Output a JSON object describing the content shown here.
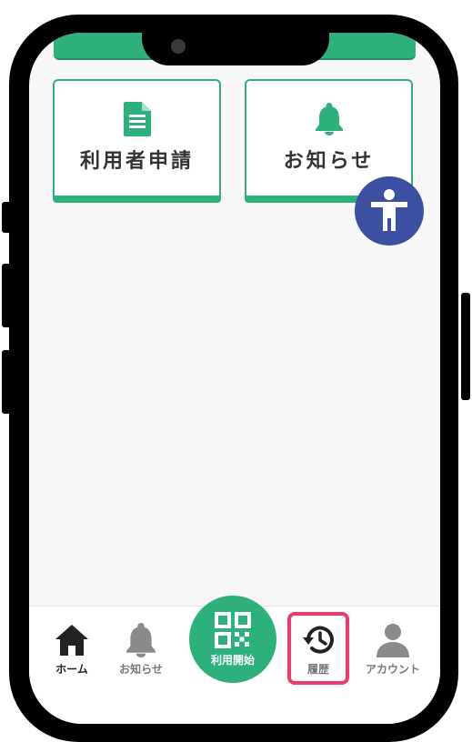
{
  "tiles": [
    {
      "label": "利用者申請",
      "icon": "document-icon"
    },
    {
      "label": "お知らせ",
      "icon": "bell-icon"
    }
  ],
  "accessibility": {
    "icon": "accessibility-person-icon",
    "color": "#3c4fa0"
  },
  "bottom_nav": {
    "items": [
      {
        "label": "ホーム",
        "icon": "home-icon",
        "active": true
      },
      {
        "label": "お知らせ",
        "icon": "bell-icon",
        "active": false
      },
      {
        "label": "利用開始",
        "icon": "qr-code-icon",
        "active": false
      },
      {
        "label": "履歴",
        "icon": "history-icon",
        "active": false,
        "highlighted": true
      },
      {
        "label": "アカウント",
        "icon": "user-icon",
        "active": false
      }
    ]
  },
  "colors": {
    "accent": "#2db07b",
    "highlight": "#f0386a",
    "icon_gray": "#8a8a8a",
    "icon_dark": "#222222"
  }
}
